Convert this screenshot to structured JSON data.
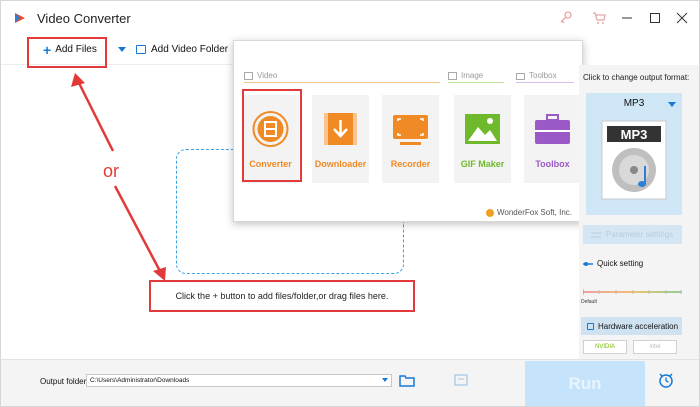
{
  "app": {
    "title": "Video Converter",
    "logo_icon": "wonderfox-logo-icon"
  },
  "titlebar": {
    "icons": [
      "key-icon",
      "cart-icon",
      "minimize-icon",
      "maximize-icon",
      "close-icon"
    ]
  },
  "toolbar": {
    "add_files_label": "Add Files",
    "add_folder_label": "Add Video Folder"
  },
  "main": {
    "drop_hint": "Click the + button to add files/folder,or drag files here.",
    "annotation_or": "or"
  },
  "popup": {
    "categories": {
      "video": "Video",
      "image": "Image",
      "toolbox": "Toolbox"
    },
    "tiles": [
      {
        "label": "Converter",
        "icon": "film-icon",
        "color": "#f08a24"
      },
      {
        "label": "Downloader",
        "icon": "download-icon",
        "color": "#f08a24"
      },
      {
        "label": "Recorder",
        "icon": "screen-record-icon",
        "color": "#f08a24"
      },
      {
        "label": "GIF Maker",
        "icon": "image-icon",
        "color": "#6fba2c"
      },
      {
        "label": "Toolbox",
        "icon": "toolbox-icon",
        "color": "#9b59c8"
      }
    ],
    "footer": "WonderFox Soft, Inc."
  },
  "right_panel": {
    "prompt": "Click to change output format:",
    "format": "MP3",
    "art_text": "MP3",
    "param_label": "Parameter settings",
    "quick_label": "Quick setting",
    "default_label": "Default",
    "hw_label": "Hardware acceleration",
    "chips": [
      "NVIDIA",
      "intel"
    ]
  },
  "bottom": {
    "output_label": "Output folder:",
    "output_path": "C:\\Users\\Administrator\\Downloads",
    "run_label": "Run"
  },
  "colors": {
    "accent": "#1779d6",
    "annotation": "#e23a3a",
    "orange": "#f08a24",
    "green": "#6fba2c",
    "purple": "#9b59c8",
    "run_bg": "#c5e3fb"
  }
}
